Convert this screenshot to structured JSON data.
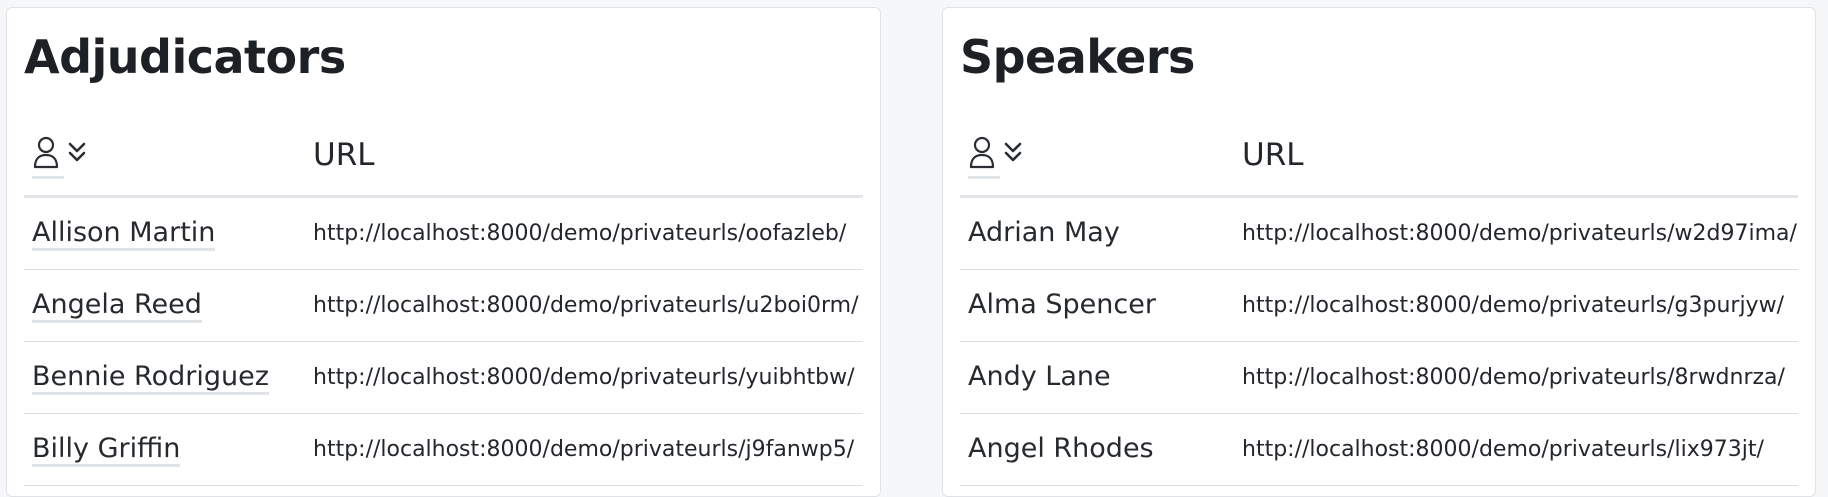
{
  "adjudicators": {
    "title": "Adjudicators",
    "url_header": "URL",
    "rows": [
      {
        "name": "Allison Martin",
        "url": "http://localhost:8000/demo/privateurls/oofazleb/"
      },
      {
        "name": "Angela Reed",
        "url": "http://localhost:8000/demo/privateurls/u2boi0rm/"
      },
      {
        "name": "Bennie Rodriguez",
        "url": "http://localhost:8000/demo/privateurls/yuibhtbw/"
      },
      {
        "name": "Billy Griffin",
        "url": "http://localhost:8000/demo/privateurls/j9fanwp5/"
      }
    ]
  },
  "speakers": {
    "title": "Speakers",
    "url_header": "URL",
    "rows": [
      {
        "name": "Adrian May",
        "url": "http://localhost:8000/demo/privateurls/w2d97ima/"
      },
      {
        "name": "Alma Spencer",
        "url": "http://localhost:8000/demo/privateurls/g3purjyw/"
      },
      {
        "name": "Andy Lane",
        "url": "http://localhost:8000/demo/privateurls/8rwdnrza/"
      },
      {
        "name": "Angel Rhodes",
        "url": "http://localhost:8000/demo/privateurls/lix973jt/"
      }
    ]
  },
  "icons": {
    "sort_column": "person-icon",
    "sort_indicator": "chevrons-down-icon"
  },
  "colors": {
    "background": "#f6f7f9",
    "card": "#ffffff",
    "text": "#1f2329",
    "divider": "#dadde1"
  }
}
